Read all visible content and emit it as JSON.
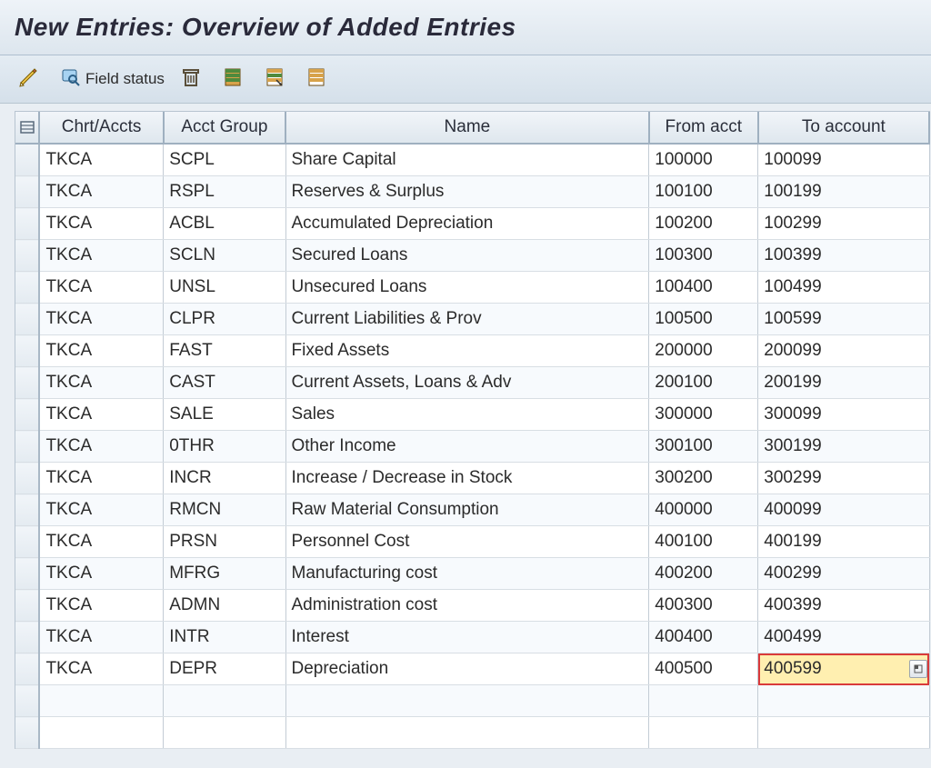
{
  "title": "New Entries: Overview of Added Entries",
  "toolbar": {
    "edit_tooltip": "Change",
    "field_status_label": "Field status",
    "delete_tooltip": "Delete",
    "select_all_tooltip": "Select All",
    "select_block_tooltip": "Select Block",
    "deselect_all_tooltip": "Deselect All"
  },
  "columns": {
    "chart": "Chrt/Accts",
    "group": "Acct Group",
    "name": "Name",
    "from": "From acct",
    "to": "To account"
  },
  "rows": [
    {
      "chart": "TKCA",
      "group": "SCPL",
      "name": "Share Capital",
      "from": "100000",
      "to": "100099"
    },
    {
      "chart": "TKCA",
      "group": "RSPL",
      "name": "Reserves & Surplus",
      "from": "100100",
      "to": "100199"
    },
    {
      "chart": "TKCA",
      "group": "ACBL",
      "name": "Accumulated Depreciation",
      "from": "100200",
      "to": "100299"
    },
    {
      "chart": "TKCA",
      "group": "SCLN",
      "name": "Secured Loans",
      "from": "100300",
      "to": "100399"
    },
    {
      "chart": "TKCA",
      "group": "UNSL",
      "name": "Unsecured Loans",
      "from": "100400",
      "to": "100499"
    },
    {
      "chart": "TKCA",
      "group": "CLPR",
      "name": "Current Liabilities & Prov",
      "from": "100500",
      "to": "100599"
    },
    {
      "chart": "TKCA",
      "group": "FAST",
      "name": "Fixed Assets",
      "from": "200000",
      "to": "200099"
    },
    {
      "chart": "TKCA",
      "group": "CAST",
      "name": "Current Assets, Loans & Adv",
      "from": "200100",
      "to": "200199"
    },
    {
      "chart": "TKCA",
      "group": "SALE",
      "name": "Sales",
      "from": "300000",
      "to": "300099"
    },
    {
      "chart": "TKCA",
      "group": "0THR",
      "name": "Other Income",
      "from": "300100",
      "to": "300199"
    },
    {
      "chart": "TKCA",
      "group": "INCR",
      "name": "Increase / Decrease in Stock",
      "from": "300200",
      "to": "300299"
    },
    {
      "chart": "TKCA",
      "group": "RMCN",
      "name": "Raw Material Consumption",
      "from": "400000",
      "to": "400099"
    },
    {
      "chart": "TKCA",
      "group": "PRSN",
      "name": "Personnel Cost",
      "from": "400100",
      "to": "400199"
    },
    {
      "chart": "TKCA",
      "group": "MFRG",
      "name": "Manufacturing cost",
      "from": "400200",
      "to": "400299"
    },
    {
      "chart": "TKCA",
      "group": "ADMN",
      "name": "Administration cost",
      "from": "400300",
      "to": "400399"
    },
    {
      "chart": "TKCA",
      "group": "INTR",
      "name": "Interest",
      "from": "400400",
      "to": "400499"
    },
    {
      "chart": "TKCA",
      "group": "DEPR",
      "name": "Depreciation",
      "from": "400500",
      "to": "400599"
    }
  ],
  "active_row_index": 16,
  "empty_trailing_rows": 2
}
